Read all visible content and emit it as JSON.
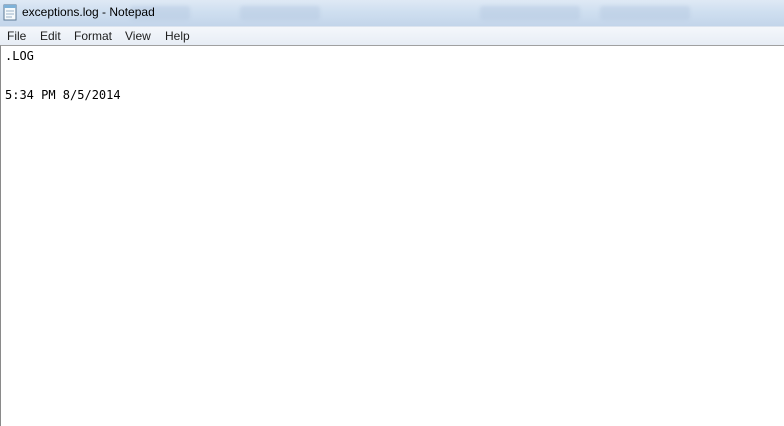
{
  "window": {
    "title": "exceptions.log - Notepad",
    "icon": "notepad-icon"
  },
  "menu": {
    "items": [
      {
        "label": "File"
      },
      {
        "label": "Edit"
      },
      {
        "label": "Format"
      },
      {
        "label": "View"
      },
      {
        "label": "Help"
      }
    ]
  },
  "editor": {
    "lines": [
      ".LOG",
      "",
      "5:34 PM 8/5/2014"
    ]
  },
  "colors": {
    "titlebar": "#cfdff0",
    "menubar": "#e7edf5",
    "editor_background": "#ffffff",
    "text": "#000000"
  }
}
